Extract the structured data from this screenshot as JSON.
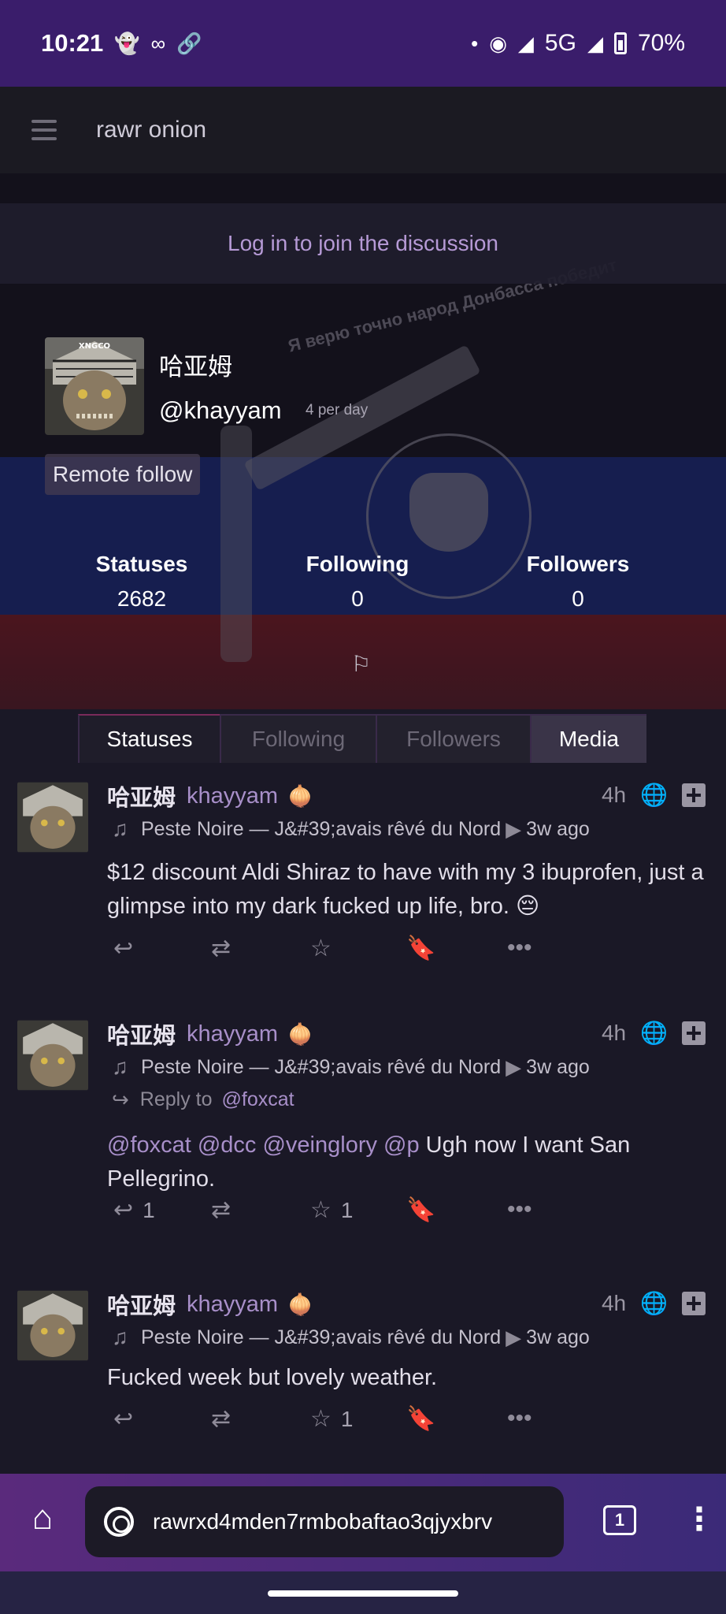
{
  "status_bar": {
    "time": "10:21",
    "network": "5G",
    "battery": "70%"
  },
  "app": {
    "title": "rawr onion"
  },
  "banner": {
    "overlay_text": "Я верю точно народ Донбасса победит",
    "login_prompt": "Log in to join the discussion"
  },
  "profile": {
    "avatar_caption": "XNGCO",
    "display_name": "哈亚姆",
    "handle": "@khayyam",
    "posts_per_day": "4 per day",
    "remote_follow_label": "Remote follow",
    "stats": [
      {
        "label": "Statuses",
        "value": "2682"
      },
      {
        "label": "Following",
        "value": "0"
      },
      {
        "label": "Followers",
        "value": "0"
      }
    ]
  },
  "tabs": [
    {
      "label": "Statuses",
      "state": "active"
    },
    {
      "label": "Following",
      "state": "inactive"
    },
    {
      "label": "Followers",
      "state": "inactive"
    },
    {
      "label": "Media",
      "state": "highlight"
    }
  ],
  "posts": [
    {
      "name": "哈亚姆",
      "user": "khayyam",
      "time": "4h",
      "now_playing": "Peste Noire — J&#39;avais rêvé du Nord",
      "now_playing_age": "3w ago",
      "reply_to": null,
      "mentions": "",
      "body": "$12 discount Aldi Shiraz to have with my 3 ibuprofen, just a glimpse into my dark fucked up life, bro. 😔",
      "reply_count": "",
      "fav_count": ""
    },
    {
      "name": "哈亚姆",
      "user": "khayyam",
      "time": "4h",
      "now_playing": "Peste Noire — J&#39;avais rêvé du Nord",
      "now_playing_age": "3w ago",
      "reply_to_label": "Reply to",
      "reply_to": "@foxcat",
      "mentions": "@foxcat @dcc @veinglory @p",
      "body": " Ugh now I want San Pellegrino.",
      "reply_count": "1",
      "fav_count": "1"
    },
    {
      "name": "哈亚姆",
      "user": "khayyam",
      "time": "4h",
      "now_playing": "Peste Noire — J&#39;avais rêvé du Nord",
      "now_playing_age": "3w ago",
      "reply_to": null,
      "mentions": "",
      "body": "Fucked week but lovely weather.",
      "reply_count": "",
      "fav_count": "1"
    }
  ],
  "browser": {
    "url": "rawrxd4mden7rmbobaftao3qjyxbrv",
    "tab_count": "1"
  },
  "colors": {
    "status_bar": "#3a1d6b",
    "accent": "#a88fc9",
    "background": "#1a1826"
  }
}
